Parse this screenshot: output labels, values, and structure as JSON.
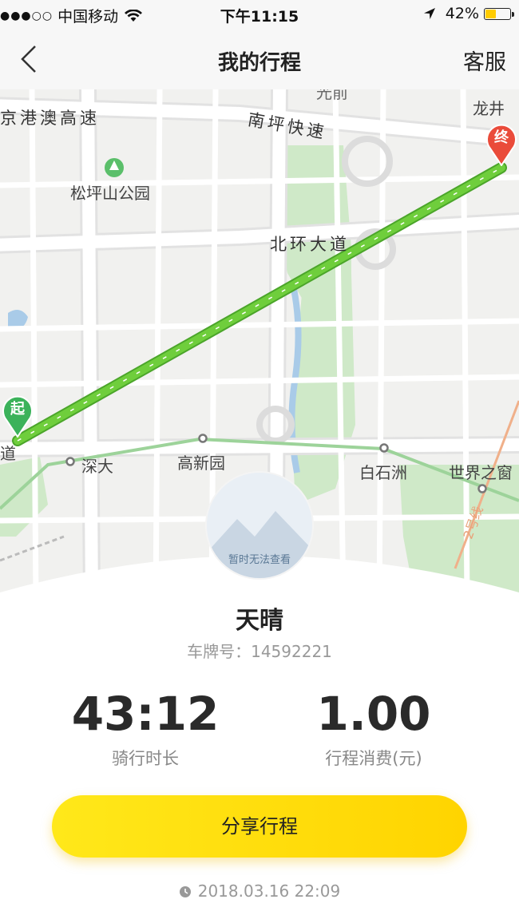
{
  "status_bar": {
    "signal": "●●●○○",
    "carrier": "中国移动",
    "time": "下午11:15",
    "battery_percent": "42%",
    "battery_level": 0.42
  },
  "nav": {
    "title": "我的行程",
    "service_label": "客服"
  },
  "map": {
    "labels": {
      "jinggang_expressway": "京港澳高速",
      "nanping_expressway": "南坪快速",
      "songpingshan_park": "松坪山公园",
      "beihuan_avenue": "北环大道",
      "longjing": "龙井",
      "shenda": "深大",
      "gaoxinyuan": "高新园",
      "baishizhou": "白石洲",
      "window_of_world": "世界之窗",
      "road_fragment": "道",
      "top_fragment": "光前",
      "line2": "2号线"
    },
    "start_label": "起",
    "end_label": "终",
    "route_color": "#6fce3c"
  },
  "profile": {
    "avatar_text": "暂时无法查看",
    "name": "天晴",
    "plate": "车牌号：14592221"
  },
  "stats": {
    "duration_value": "43:12",
    "duration_label": "骑行时长",
    "cost_value": "1.00",
    "cost_label": "行程消费(元)"
  },
  "share_label": "分享行程",
  "timestamp": "2018.03.16 22:09"
}
